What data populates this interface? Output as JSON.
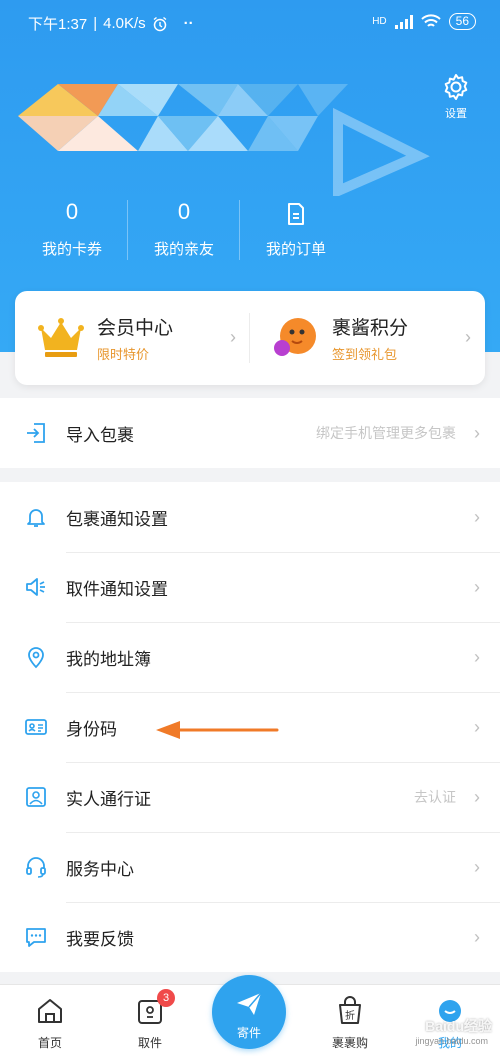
{
  "status_bar": {
    "time": "下午1:37",
    "speed": "4.0K/s",
    "dots": "··",
    "signal_label": "HD",
    "battery": "56"
  },
  "header": {
    "settings_label": "设置"
  },
  "stats": [
    {
      "value": "0",
      "label": "我的卡券"
    },
    {
      "value": "0",
      "label": "我的亲友"
    },
    {
      "label": "我的订单"
    }
  ],
  "member_card": {
    "left": {
      "title": "会员中心",
      "subtitle": "限时特价"
    },
    "right": {
      "title": "裹酱积分",
      "subtitle": "签到领礼包"
    }
  },
  "import_row": {
    "label": "导入包裹",
    "hint": "绑定手机管理更多包裹"
  },
  "menu": [
    {
      "label": "包裹通知设置",
      "icon": "bell-icon"
    },
    {
      "label": "取件通知设置",
      "icon": "speaker-icon"
    },
    {
      "label": "我的地址簿",
      "icon": "location-icon"
    },
    {
      "label": "身份码",
      "icon": "id-card-icon"
    },
    {
      "label": "实人通行证",
      "icon": "person-badge-icon",
      "hint": "去认证"
    },
    {
      "label": "服务中心",
      "icon": "headset-icon"
    },
    {
      "label": "我要反馈",
      "icon": "message-icon"
    }
  ],
  "tabbar": {
    "home": "首页",
    "pickup": "取件",
    "pickup_badge": "3",
    "send": "寄件",
    "shop": "裹裹购",
    "mine": "我的"
  },
  "watermark": {
    "brand": "Baidu经验",
    "url": "jingyan.baidu.com"
  },
  "colors": {
    "accent": "#2fa3ee",
    "orange_text": "#e8962d",
    "arrow_annotation": "#f07a28"
  }
}
